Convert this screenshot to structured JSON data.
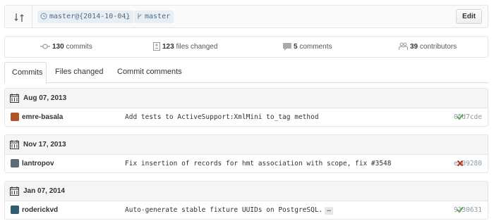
{
  "range": {
    "base": "master@{2014-10-04}",
    "separator": "...",
    "head": "master",
    "edit_label": "Edit"
  },
  "summary": {
    "commits": {
      "count": "130",
      "label": "commits"
    },
    "files": {
      "count": "123",
      "label": "files changed"
    },
    "comments": {
      "count": "5",
      "label": "comments"
    },
    "contributors": {
      "count": "39",
      "label": "contributors"
    }
  },
  "tabs": [
    {
      "label": "Commits",
      "selected": true
    },
    {
      "label": "Files changed",
      "selected": false
    },
    {
      "label": "Commit comments",
      "selected": false
    }
  ],
  "groups": [
    {
      "date": "Aug 07, 2013",
      "commit": {
        "author": "emre-basala",
        "message": "Add tests to ActiveSupport:XmlMini to_tag method",
        "status": "success",
        "sha": "05d7cde",
        "avatar_color": "#b0532a"
      }
    },
    {
      "date": "Nov 17, 2013",
      "commit": {
        "author": "lantropov",
        "message": "Fix insertion of records for hmt association with scope, fix #3548",
        "status": "failure",
        "sha": "ec09280",
        "avatar_color": "#5a6b7a"
      }
    },
    {
      "date": "Jan 07, 2014",
      "commit": {
        "author": "roderickvd",
        "message": "Auto-generate stable fixture UUIDs on PostgreSQL.",
        "ellipsis": "…",
        "status": "success",
        "sha": "9330631",
        "avatar_color": "#2f5e6e"
      }
    }
  ],
  "colors": {
    "success": "#55a532",
    "failure": "#bd2c00",
    "chip_bg": "#e8eff4",
    "sha": "#8a9aa8"
  },
  "icons": {
    "compare": "git-compare-icon",
    "branch": "git-branch-icon",
    "calendar": "calendar-icon"
  }
}
